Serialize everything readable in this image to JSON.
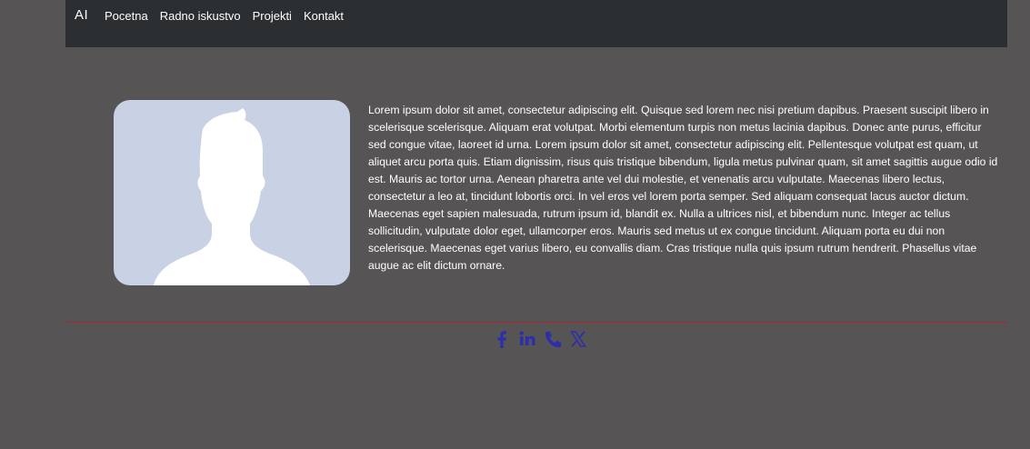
{
  "nav": {
    "brand": "AI",
    "links": [
      "Pocetna",
      "Radno iskustvo",
      "Projekti",
      "Kontakt"
    ]
  },
  "profile": {
    "bio": "Lorem ipsum dolor sit amet, consectetur adipiscing elit. Quisque sed lorem nec nisi pretium dapibus. Praesent suscipit libero in scelerisque scelerisque. Aliquam erat volutpat. Morbi elementum turpis non metus lacinia dapibus. Donec ante purus, efficitur sed congue vitae, laoreet id urna. Lorem ipsum dolor sit amet, consectetur adipiscing elit. Pellentesque volutpat est quam, ut aliquet arcu porta quis. Etiam dignissim, risus quis tristique bibendum, ligula metus pulvinar quam, sit amet sagittis augue odio id est. Mauris ac tortor urna. Aenean pharetra ante vel dui molestie, et venenatis arcu vulputate. Maecenas libero lectus, consectetur a leo at, tincidunt lobortis orci. In vel eros vel lorem porta semper. Sed aliquam consequat lacus auctor dictum. Maecenas eget sapien malesuada, rutrum ipsum id, blandit ex. Nulla a ultrices nisl, et bibendum nunc. Integer ac tellus sollicitudin, vulputate dolor eget, ullamcorper eros. Mauris sed metus ut ex congue tincidunt. Aliquam porta eu dui non scelerisque. Maecenas eget varius libero, eu convallis diam. Cras tristique nulla quis ipsum rutrum hendrerit. Phasellus vitae augue ac elit dictum ornare.",
    "avatar_icon": "user-silhouette-icon"
  },
  "footer": {
    "social_icons": [
      "facebook-icon",
      "linkedin-icon",
      "phone-icon",
      "x-twitter-icon"
    ]
  },
  "colors": {
    "background": "#565455",
    "navbar": "#2b2f32",
    "divider": "#a8262d",
    "social_icon": "#2e2fa8",
    "avatar_bg": "#c8d2e4"
  }
}
